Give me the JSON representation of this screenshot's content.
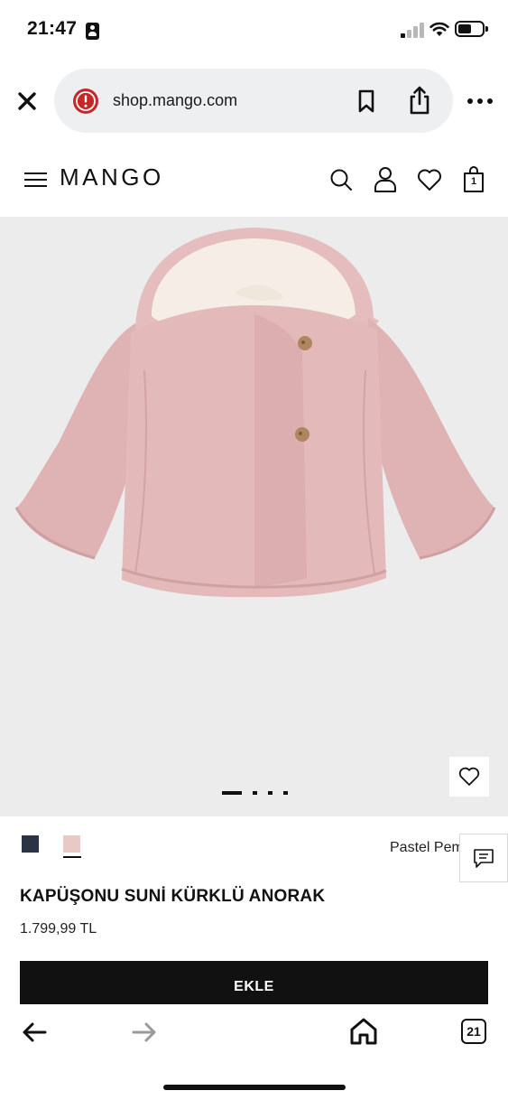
{
  "status_bar": {
    "time": "21:47",
    "battery_level": 0.55,
    "signal_bars_active": 1,
    "signal_bars_total": 4
  },
  "browser": {
    "url": "shop.mango.com",
    "icons": {
      "close": "close-icon",
      "warning": "warning-icon",
      "bookmark": "bookmark-icon",
      "share": "share-icon",
      "more": "more-icon"
    }
  },
  "header": {
    "brand": "MANGO",
    "bag_count": "1",
    "icons": [
      "menu-icon",
      "search-icon",
      "account-icon",
      "heart-icon",
      "shopping-bag-icon"
    ]
  },
  "gallery": {
    "image_count": 4,
    "active_index": 0,
    "colors": {
      "background": "#ececec",
      "jacket": "#e2b9ba",
      "lining": "#f5ede6"
    }
  },
  "product": {
    "colors": [
      {
        "hex": "#2c3444",
        "selected": false
      },
      {
        "hex": "#e9c9c6",
        "selected": true
      }
    ],
    "color_name": "Pastel Pembe",
    "title": "KAPÜŞONU SUNİ KÜRKLÜ ANORAK",
    "price": "1.799,99 TL",
    "add_label": "EKLE"
  },
  "toolbar": {
    "tab_count": "21",
    "icons": [
      "back-arrow-icon",
      "forward-arrow-icon",
      "home-icon",
      "tabs-icon"
    ]
  }
}
